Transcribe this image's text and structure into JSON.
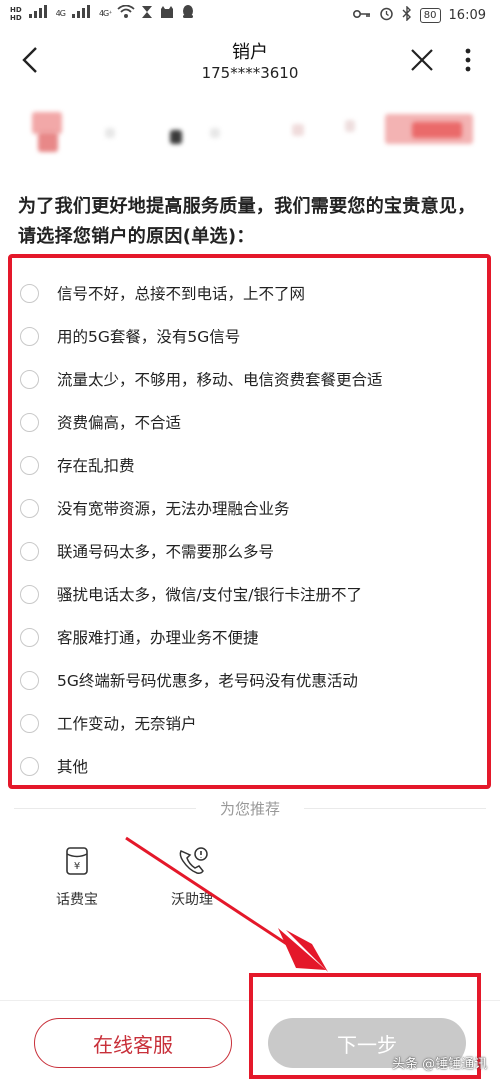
{
  "status_bar": {
    "hd1": "HD",
    "hd2": "HD",
    "sig1": "4G",
    "sig2": "4G⁺",
    "battery": "80",
    "time": "16:09"
  },
  "nav": {
    "title": "销户",
    "subtitle": "175****3610"
  },
  "heading": "为了我们更好地提高服务质量，我们需要您的宝贵意见，请选择您销户的原因(单选)：",
  "options": [
    "信号不好，总接不到电话，上不了网",
    "用的5G套餐，没有5G信号",
    "流量太少，不够用，移动、电信资费套餐更合适",
    "资费偏高，不合适",
    "存在乱扣费",
    "没有宽带资源，无法办理融合业务",
    "联通号码太多，不需要那么多号",
    "骚扰电话太多，微信/支付宝/银行卡注册不了",
    "客服难打通，办理业务不便捷",
    "5G终端新号码优惠多，老号码没有优惠活动",
    "工作变动，无奈销户",
    "其他"
  ],
  "recommend": {
    "label": "为您推荐",
    "items": [
      {
        "label": "话费宝",
        "icon": "wallet-icon"
      },
      {
        "label": "沃助理",
        "icon": "phone-assistant-icon"
      }
    ]
  },
  "buttons": {
    "service": "在线客服",
    "next": "下一步"
  },
  "watermark": "头条 @锤锤通讯",
  "colors": {
    "highlight": "#e4182a",
    "brand": "#c8303a",
    "disabled": "#c9c9c9"
  }
}
